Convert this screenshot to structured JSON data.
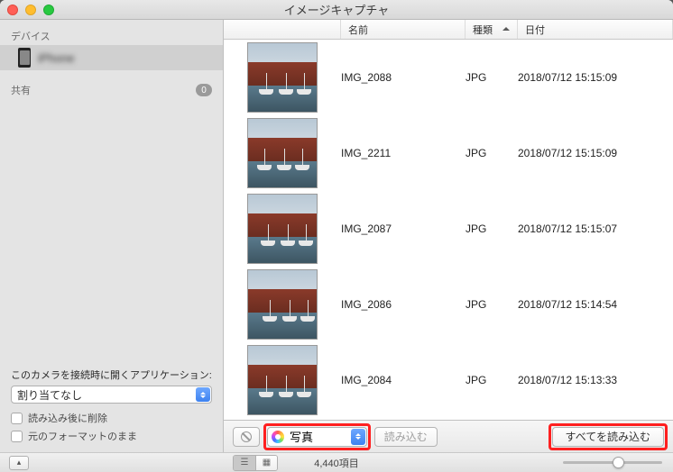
{
  "window": {
    "title": "イメージキャプチャ"
  },
  "sidebar": {
    "devices_heading": "デバイス",
    "device_name": "iPhone",
    "shared_heading": "共有",
    "shared_badge": "0",
    "bottom_label": "このカメラを接続時に開くアプリケーション:",
    "app_popup": "割り当てなし",
    "delete_after_import": "読み込み後に削除",
    "keep_original": "元のフォーマットのまま"
  },
  "columns": {
    "name": "名前",
    "type": "種類",
    "date": "日付"
  },
  "items": [
    {
      "name": "IMG_2088",
      "type": "JPG",
      "date": "2018/07/12 15:15:09"
    },
    {
      "name": "IMG_2211",
      "type": "JPG",
      "date": "2018/07/12 15:15:09"
    },
    {
      "name": "IMG_2087",
      "type": "JPG",
      "date": "2018/07/12 15:15:07"
    },
    {
      "name": "IMG_2086",
      "type": "JPG",
      "date": "2018/07/12 15:14:54"
    },
    {
      "name": "IMG_2084",
      "type": "JPG",
      "date": "2018/07/12 15:13:33"
    }
  ],
  "toolbar": {
    "destination": "写真",
    "import": "読み込む",
    "import_all": "すべてを読み込む"
  },
  "status": {
    "count": "4,440項目"
  }
}
